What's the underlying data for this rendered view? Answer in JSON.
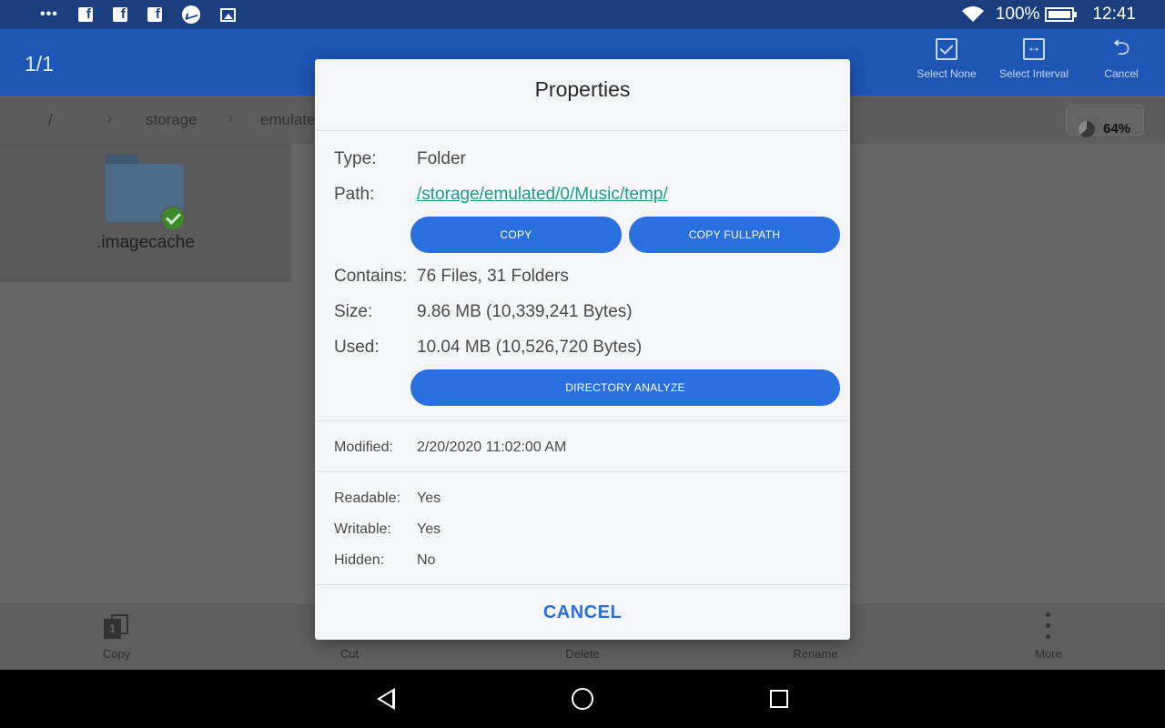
{
  "status_bar": {
    "overflow": "•••",
    "notif_fb": "f",
    "battery": "100%",
    "time": "12:41"
  },
  "app_bar": {
    "selection_count": "1/1",
    "actions": [
      {
        "label": "Select None",
        "icon": "select-none-icon"
      },
      {
        "label": "Select Interval",
        "icon": "select-interval-icon"
      },
      {
        "label": "Cancel",
        "icon": "return-icon"
      }
    ]
  },
  "breadcrumb": {
    "root": "/",
    "items": [
      "storage",
      "emulate"
    ],
    "storage_percent": "64%"
  },
  "files": [
    {
      "name": ".imagecache",
      "selected": true
    }
  ],
  "toolbar": {
    "items": [
      "Copy",
      "Cut",
      "Delete",
      "Rename",
      "More"
    ],
    "copy_badge": "1"
  },
  "dialog": {
    "title": "Properties",
    "type_label": "Type:",
    "type_value": "Folder",
    "path_label": "Path:",
    "path_value": "/storage/emulated/0/Music/temp/",
    "copy_button": "COPY",
    "copy_fullpath_button": "COPY FULLPATH",
    "contains_label": "Contains:",
    "contains_value": "76 Files, 31 Folders",
    "size_label": "Size:",
    "size_value": "9.86 MB (10,339,241 Bytes)",
    "used_label": "Used:",
    "used_value": "10.04 MB (10,526,720 Bytes)",
    "analyze_button": "DIRECTORY ANALYZE",
    "modified_label": "Modified:",
    "modified_value": "2/20/2020 11:02:00 AM",
    "readable_label": "Readable:",
    "readable_value": "Yes",
    "writable_label": "Writable:",
    "writable_value": "Yes",
    "hidden_label": "Hidden:",
    "hidden_value": "No",
    "cancel_button": "CANCEL"
  },
  "colors": {
    "app_bar": "#1d56b5",
    "status_bar": "#1a3f7e",
    "accent_button": "#2a6fe0",
    "link": "#1d9a8a"
  }
}
